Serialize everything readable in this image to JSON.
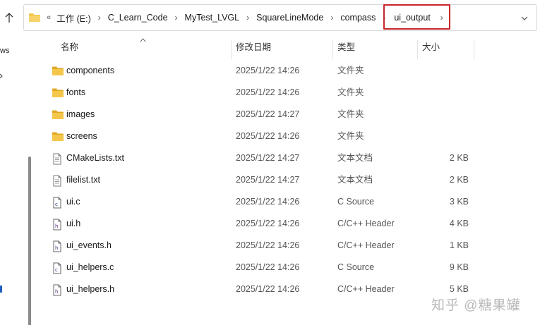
{
  "address_bar": {
    "overflow": "«",
    "crumbs": [
      "工作 (E:)",
      "C_Learn_Code",
      "MyTest_LVGL",
      "SquareLineMode",
      "compass",
      "ui_output"
    ],
    "separator": "›",
    "highlight_color": "#c8262b"
  },
  "nav_fragments": [
    "ws"
  ],
  "columns": {
    "name": "名称",
    "date": "修改日期",
    "type": "类型",
    "size": "大小"
  },
  "files": [
    {
      "name": "components",
      "date": "2025/1/22 14:26",
      "type": "文件夹",
      "size": "",
      "icon": "folder-icon"
    },
    {
      "name": "fonts",
      "date": "2025/1/22 14:26",
      "type": "文件夹",
      "size": "",
      "icon": "folder-icon"
    },
    {
      "name": "images",
      "date": "2025/1/22 14:27",
      "type": "文件夹",
      "size": "",
      "icon": "folder-icon"
    },
    {
      "name": "screens",
      "date": "2025/1/22 14:26",
      "type": "文件夹",
      "size": "",
      "icon": "folder-icon"
    },
    {
      "name": "CMakeLists.txt",
      "date": "2025/1/22 14:27",
      "type": "文本文档",
      "size": "2 KB",
      "icon": "text-file-icon"
    },
    {
      "name": "filelist.txt",
      "date": "2025/1/22 14:27",
      "type": "文本文档",
      "size": "2 KB",
      "icon": "text-file-icon"
    },
    {
      "name": "ui.c",
      "date": "2025/1/22 14:26",
      "type": "C Source",
      "size": "3 KB",
      "icon": "c-source-icon"
    },
    {
      "name": "ui.h",
      "date": "2025/1/22 14:26",
      "type": "C/C++ Header",
      "size": "4 KB",
      "icon": "header-file-icon"
    },
    {
      "name": "ui_events.h",
      "date": "2025/1/22 14:26",
      "type": "C/C++ Header",
      "size": "1 KB",
      "icon": "header-file-icon"
    },
    {
      "name": "ui_helpers.c",
      "date": "2025/1/22 14:26",
      "type": "C Source",
      "size": "9 KB",
      "icon": "c-source-icon"
    },
    {
      "name": "ui_helpers.h",
      "date": "2025/1/22 14:26",
      "type": "C/C++ Header",
      "size": "5 KB",
      "icon": "header-file-icon"
    }
  ],
  "watermark": "知乎 @糖果罐",
  "colors": {
    "folder": "#f4c74b",
    "folder_dark": "#e0a824",
    "accent_border": "#c8262b"
  }
}
